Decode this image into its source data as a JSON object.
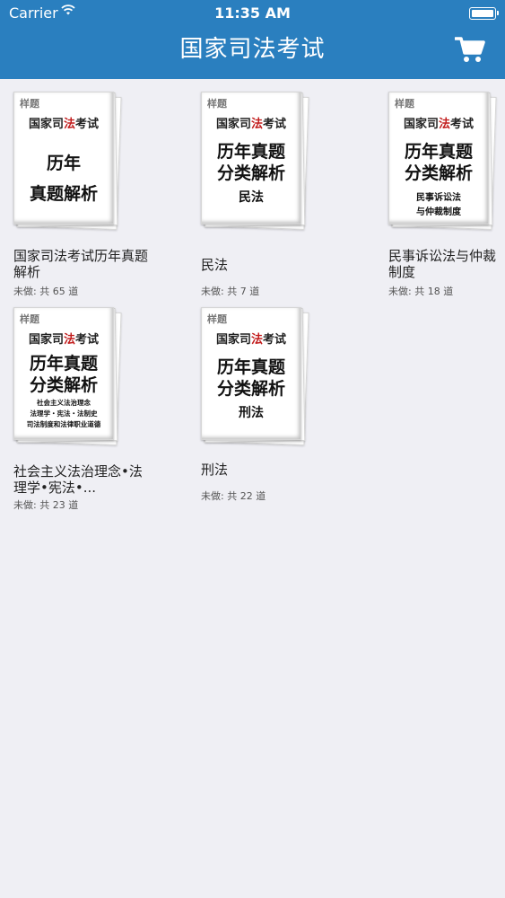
{
  "status": {
    "carrier": "Carrier",
    "time": "11:35 AM"
  },
  "nav": {
    "title": "国家司法考试"
  },
  "books": [
    {
      "cover": {
        "tag": "样题",
        "brand_a": "国家司",
        "brand_hl": "法",
        "brand_b": "考试",
        "line1": "历年",
        "line2": "真题解析",
        "sub": ""
      },
      "label": "国家司法考试历年真题解析",
      "meta": "未做: 共 65 道"
    },
    {
      "cover": {
        "tag": "样题",
        "brand_a": "国家司",
        "brand_hl": "法",
        "brand_b": "考试",
        "line1": "历年真题",
        "line2": "分类解析",
        "sub": "民法"
      },
      "label": "民法",
      "meta": "未做: 共 7 道"
    },
    {
      "cover": {
        "tag": "样题",
        "brand_a": "国家司",
        "brand_hl": "法",
        "brand_b": "考试",
        "line1": "历年真题",
        "line2": "分类解析",
        "sub": "民事诉讼法\n与仲裁制度"
      },
      "label": "民事诉讼法与仲裁制度",
      "meta": "未做: 共 18 道"
    },
    {
      "cover": {
        "tag": "样题",
        "brand_a": "国家司",
        "brand_hl": "法",
        "brand_b": "考试",
        "line1": "历年真题",
        "line2": "分类解析",
        "sub": "社会主义法治理念\n法理学・宪法・法制史\n司法制度和法律职业道德"
      },
      "label": "社会主义法治理念•法理学•宪法•...",
      "meta": "未做: 共 23 道"
    },
    {
      "cover": {
        "tag": "样题",
        "brand_a": "国家司",
        "brand_hl": "法",
        "brand_b": "考试",
        "line1": "历年真题",
        "line2": "分类解析",
        "sub": "刑法"
      },
      "label": "刑法",
      "meta": "未做: 共 22 道"
    }
  ],
  "colors": {
    "nav_bg": "#2a7fbf",
    "page_bg": "#efeff4",
    "accent_red": "#c21d1d"
  }
}
